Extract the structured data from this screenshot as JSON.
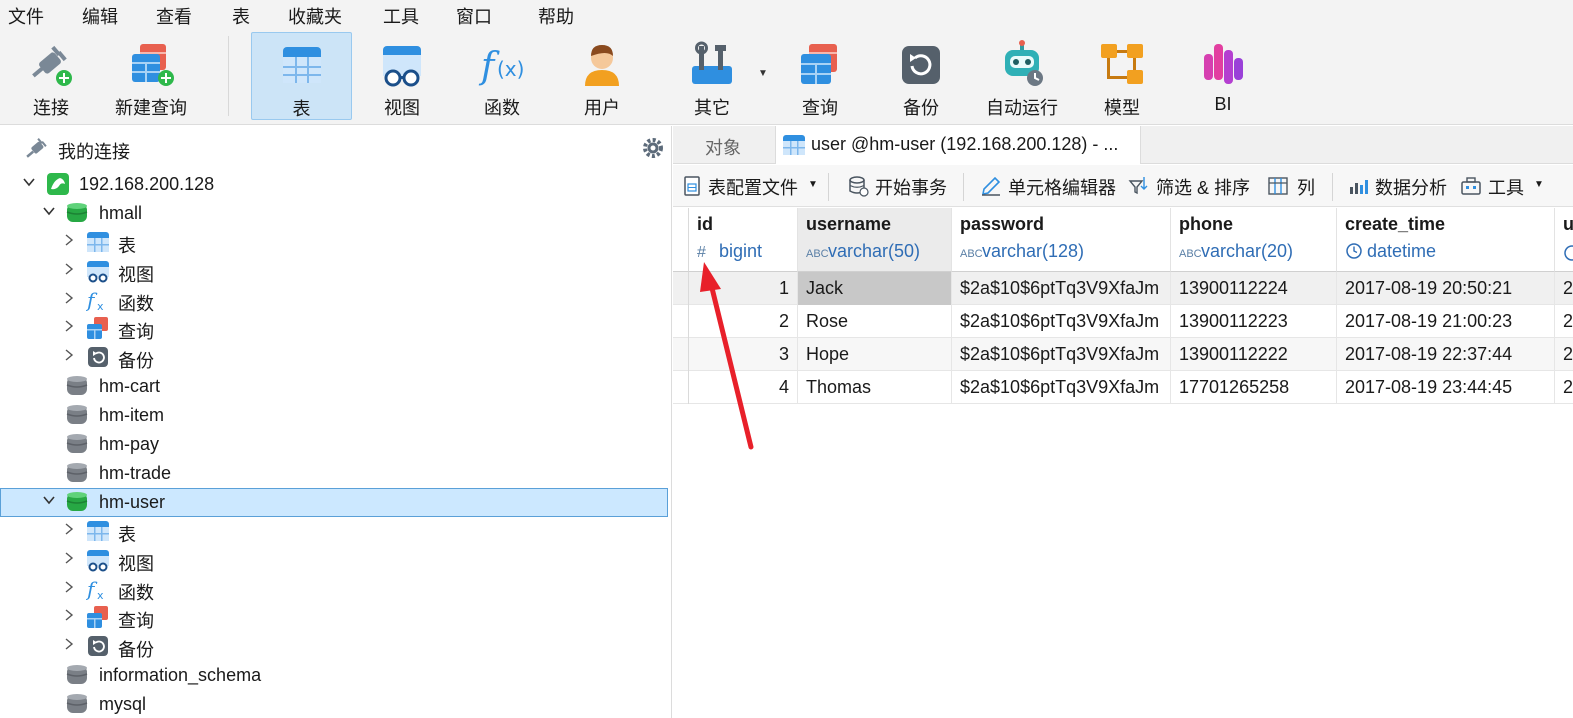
{
  "menu": [
    "文件",
    "编辑",
    "查看",
    "表",
    "收藏夹",
    "工具",
    "窗口",
    "帮助"
  ],
  "toolbar": {
    "items": [
      {
        "label": "连接",
        "icon": "connect-plug-icon"
      },
      {
        "label": "新建查询",
        "icon": "new-query-icon"
      },
      {
        "label": "表",
        "icon": "table-icon"
      },
      {
        "label": "视图",
        "icon": "view-icon"
      },
      {
        "label": "函数",
        "icon": "function-icon"
      },
      {
        "label": "用户",
        "icon": "user-icon"
      },
      {
        "label": "其它",
        "icon": "tools-icon"
      },
      {
        "label": "查询",
        "icon": "query-icon"
      },
      {
        "label": "备份",
        "icon": "backup-icon"
      },
      {
        "label": "自动运行",
        "icon": "robot-icon"
      },
      {
        "label": "模型",
        "icon": "model-icon"
      },
      {
        "label": "BI",
        "icon": "bi-icon"
      }
    ],
    "active": "表"
  },
  "navigator": {
    "header": "我的连接",
    "connection": "192.168.200.128",
    "db_hmall": "hmall",
    "hmall_children": [
      "表",
      "视图",
      "函数",
      "查询",
      "备份"
    ],
    "dbs_collapsed": [
      "hm-cart",
      "hm-item",
      "hm-pay",
      "hm-trade"
    ],
    "db_hm_user": "hm-user",
    "hm_user_children": [
      "表",
      "视图",
      "函数",
      "查询",
      "备份"
    ],
    "dbs_tail": [
      "information_schema",
      "mysql"
    ]
  },
  "tabs": {
    "objects": "对象",
    "active": "user @hm-user (192.168.200.128) - ..."
  },
  "subtoolbar": {
    "profile": "表配置文件",
    "begin_tx": "开始事务",
    "cell_editor": "单元格编辑器",
    "filter_sort": "筛选 & 排序",
    "columns": "列",
    "analysis": "数据分析",
    "tools": "工具"
  },
  "grid": {
    "columns": [
      {
        "name": "id",
        "type": "bigint",
        "type_icon": "#"
      },
      {
        "name": "username",
        "type": "varchar(50)",
        "type_icon": "ABC"
      },
      {
        "name": "password",
        "type": "varchar(128)",
        "type_icon": "ABC"
      },
      {
        "name": "phone",
        "type": "varchar(20)",
        "type_icon": "ABC"
      },
      {
        "name": "create_time",
        "type": "datetime",
        "type_icon": "clock"
      },
      {
        "name": "u",
        "type": "",
        "type_icon": "clock"
      }
    ],
    "rows": [
      [
        "1",
        "Jack",
        "$2a$10$6ptTq3V9XfaJm",
        "13900112224",
        "2017-08-19 20:50:21",
        "2"
      ],
      [
        "2",
        "Rose",
        "$2a$10$6ptTq3V9XfaJm",
        "13900112223",
        "2017-08-19 21:00:23",
        "2"
      ],
      [
        "3",
        "Hope",
        "$2a$10$6ptTq3V9XfaJm",
        "13900112222",
        "2017-08-19 22:37:44",
        "2"
      ],
      [
        "4",
        "Thomas",
        "$2a$10$6ptTq3V9XfaJm",
        "17701265258",
        "2017-08-19 23:44:45",
        "2"
      ]
    ]
  },
  "colors": {
    "accent": "#cce4f7",
    "selection_border": "#5aa0d8",
    "annotation_arrow": "#e8202a",
    "type_text": "#2f6db5"
  }
}
